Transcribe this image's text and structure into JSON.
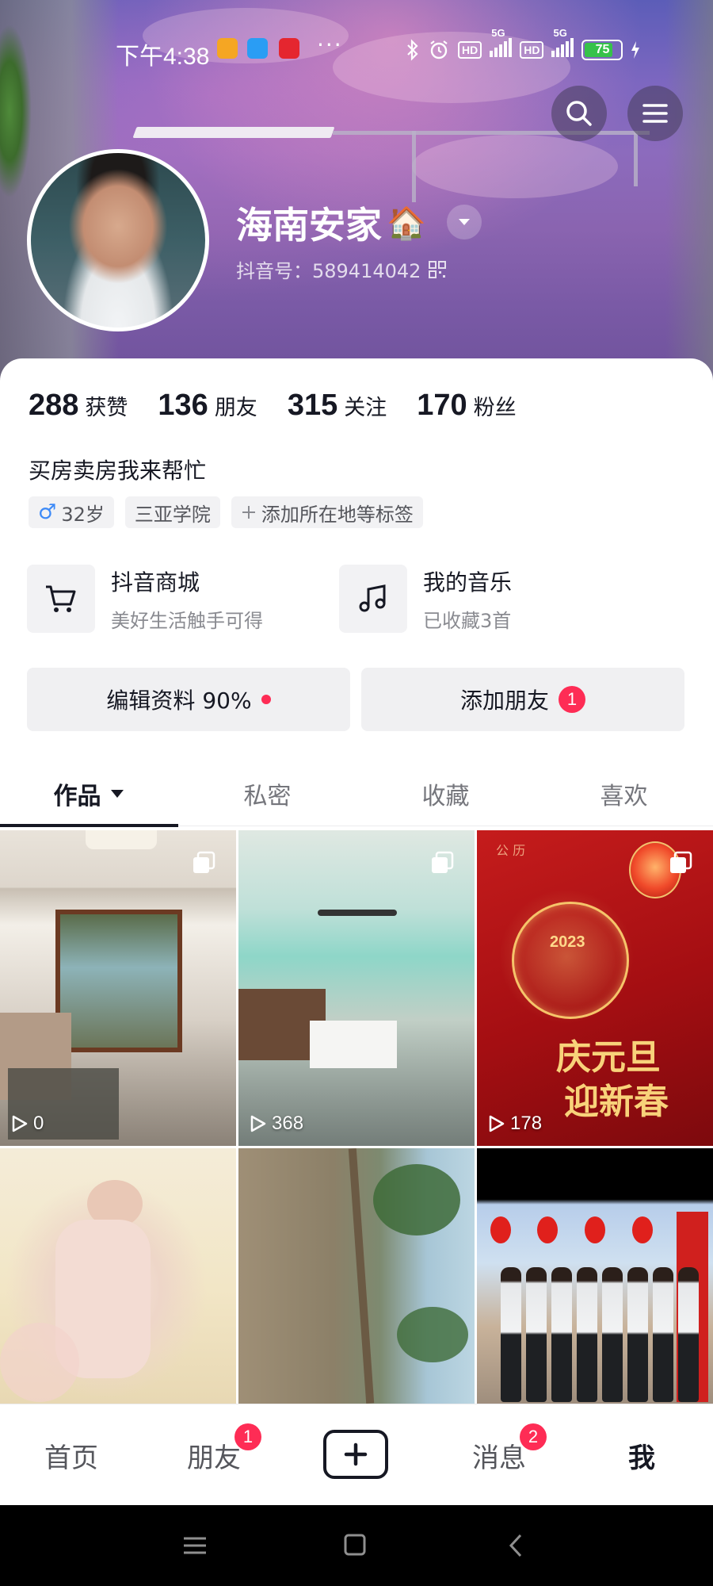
{
  "status_bar": {
    "time": "下午4:38",
    "more": "···",
    "network_1": "5G",
    "network_2": "5G",
    "hd_1": "HD",
    "hd_2": "HD",
    "battery": "75"
  },
  "header": {
    "username": "海南安家",
    "username_emoji": "🏠",
    "douyin_id_label": "抖音号：",
    "douyin_id": "589414042"
  },
  "stats": [
    {
      "num": "288",
      "label": "获赞"
    },
    {
      "num": "136",
      "label": "朋友"
    },
    {
      "num": "315",
      "label": "关注"
    },
    {
      "num": "170",
      "label": "粉丝"
    }
  ],
  "bio": "买房卖房我来帮忙",
  "tags": {
    "gender_symbol": "♂",
    "age": "32岁",
    "school": "三亚学院",
    "add_location": "添加所在地等标签"
  },
  "features": {
    "mall_title": "抖音商城",
    "mall_sub": "美好生活触手可得",
    "music_title": "我的音乐",
    "music_sub": "已收藏3首"
  },
  "actions": {
    "edit_profile": "编辑资料 90%",
    "add_friends": "添加朋友",
    "add_friends_badge": "1"
  },
  "tabs": [
    {
      "label": "作品"
    },
    {
      "label": "私密"
    },
    {
      "label": "收藏"
    },
    {
      "label": "喜欢"
    }
  ],
  "videos": [
    {
      "plays": "0"
    },
    {
      "plays": "368"
    },
    {
      "plays": "178",
      "calendar": "公  历",
      "year": "2023",
      "greeting_line1": "庆元旦",
      "greeting_line2": "迎新春"
    },
    {},
    {},
    {}
  ],
  "bottom_nav": {
    "home": "首页",
    "friends": "朋友",
    "friends_badge": "1",
    "messages": "消息",
    "messages_badge": "2",
    "me": "我"
  },
  "colors": {
    "accent_red": "#fe2c55",
    "text_primary": "#161823",
    "battery_green": "#36c24a"
  },
  "icons": [
    "search-icon",
    "menu-icon",
    "dropdown-icon",
    "qr-code-icon",
    "cart-icon",
    "music-note-icon",
    "caret-down-icon",
    "multi-image-icon",
    "play-icon",
    "plus-icon",
    "home-nav-icon",
    "square-nav-icon",
    "back-nav-icon"
  ]
}
